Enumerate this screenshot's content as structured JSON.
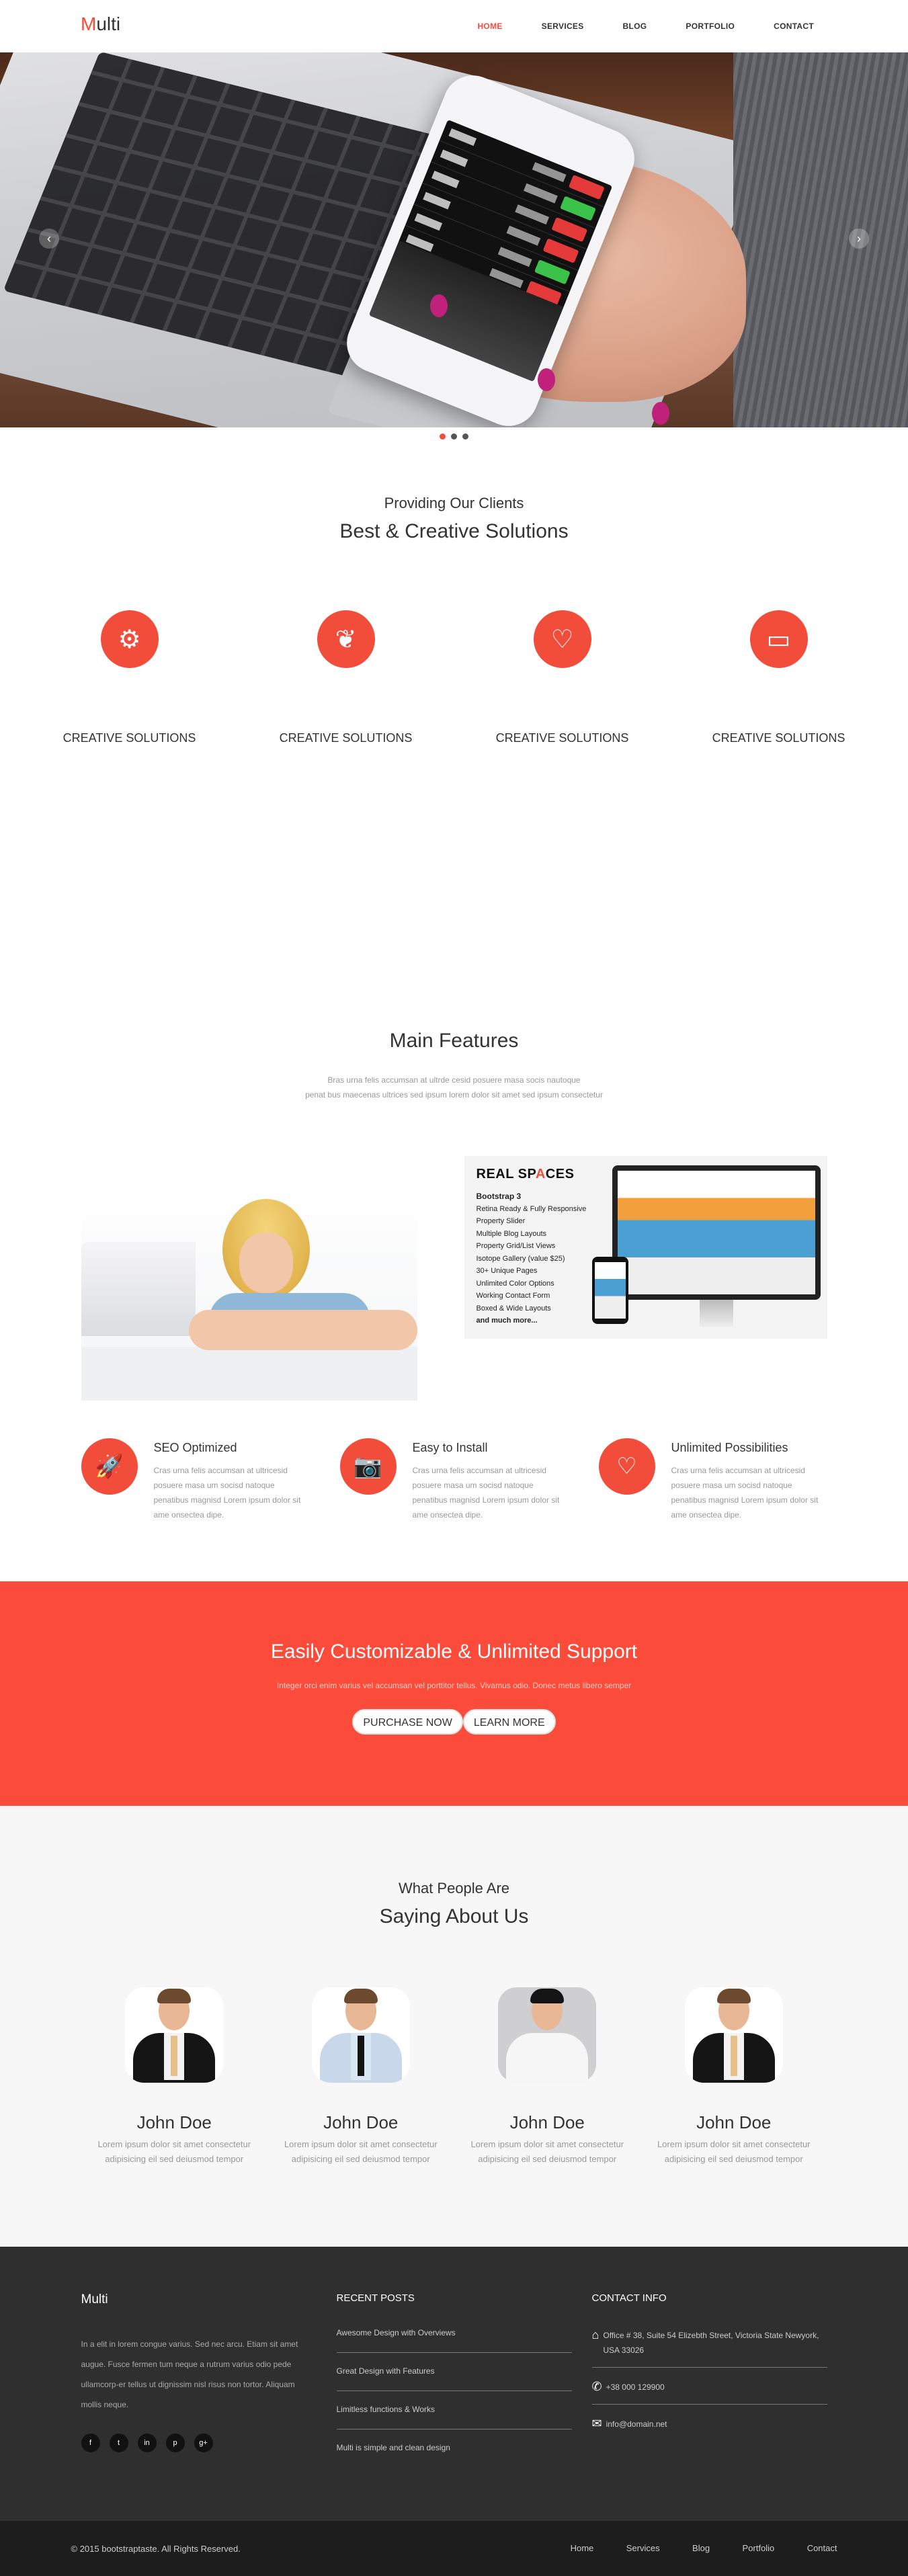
{
  "header": {
    "logo_first": "M",
    "logo_rest": "ulti",
    "nav": [
      {
        "label": "HOME",
        "active": true
      },
      {
        "label": "SERVICES"
      },
      {
        "label": "BLOG"
      },
      {
        "label": "PORTFOLIO"
      },
      {
        "label": "CONTACT"
      }
    ]
  },
  "hero": {
    "prev_icon": "chevron-left-icon",
    "next_icon": "chevron-right-icon",
    "prev_glyph": "‹",
    "next_glyph": "›",
    "slides_count": 3,
    "active_slide": 1
  },
  "solutions": {
    "subtitle": "Providing Our Clients",
    "title": "Best & Creative Solutions",
    "items": [
      {
        "icon": "gears-icon",
        "glyph": "⚙",
        "label": "CREATIVE SOLUTIONS"
      },
      {
        "icon": "leaf-icon",
        "glyph": "❦",
        "label": "CREATIVE SOLUTIONS"
      },
      {
        "icon": "heart-icon",
        "glyph": "♡",
        "label": "CREATIVE SOLUTIONS"
      },
      {
        "icon": "laptop-icon",
        "glyph": "▭",
        "label": "CREATIVE SOLUTIONS"
      }
    ]
  },
  "features": {
    "title": "Main Features",
    "desc_line1": "Bras urna felis accumsan at ultrde cesid posuere masa socis nautoque",
    "desc_line2": "penat bus maecenas ultrices sed ipsum lorem dolor sit amet sed ipsum consectetur",
    "realspaces": {
      "title_a": "REAL SP",
      "title_b": "A",
      "title_c": "CES",
      "list": [
        "Bootstrap 3",
        "Retina Ready & Fully Responsive",
        "Property Slider",
        "Multiple Blog Layouts",
        "Property Grid/List Views",
        "Isotope Gallery (value $25)",
        "30+ Unique Pages",
        "Unlimited Color Options",
        "Working Contact Form",
        "Boxed & Wide Layouts",
        "and much more..."
      ]
    },
    "perks": [
      {
        "icon": "rocket-icon",
        "glyph": "🚀",
        "title": "SEO Optimized",
        "text": "Cras urna felis accumsan at ultricesid posuere masa um socisd natoque penatibus magnisd Lorem ipsum dolor sit ame onsectea dipe."
      },
      {
        "icon": "camera-icon",
        "glyph": "📷",
        "title": "Easy to Install",
        "text": "Cras urna felis accumsan at ultricesid posuere masa um socisd natoque penatibus magnisd Lorem ipsum dolor sit ame onsectea dipe."
      },
      {
        "icon": "heart-icon",
        "glyph": "♡",
        "title": "Unlimited Possibilities",
        "text": "Cras urna felis accumsan at ultricesid posuere masa um socisd natoque penatibus magnisd Lorem ipsum dolor sit ame onsectea dipe."
      }
    ]
  },
  "cta": {
    "title": "Easily Customizable & Unlimited Support",
    "text": "Integer orci enim varius vel accumsan vel porttitor tellus. Vivamus odio. Donec metus libero semper",
    "purchase_label": "PURCHASE NOW",
    "learn_label": "LEARN MORE"
  },
  "testimonials": {
    "subtitle": "What People Are",
    "title": "Saying About Us",
    "people": [
      {
        "name": "John Doe",
        "line1": "Lorem ipsum dolor sit amet consectetur",
        "line2": "adipisicing eil sed deiusmod tempor"
      },
      {
        "name": "John Doe",
        "line1": "Lorem ipsum dolor sit amet consectetur",
        "line2": "adipisicing eil sed deiusmod tempor"
      },
      {
        "name": "John Doe",
        "line1": "Lorem ipsum dolor sit amet consectetur",
        "line2": "adipisicing eil sed deiusmod tempor"
      },
      {
        "name": "John Doe",
        "line1": "Lorem ipsum dolor sit amet consectetur",
        "line2": "adipisicing eil sed deiusmod tempor"
      }
    ]
  },
  "footer": {
    "brand": "Multi",
    "about": "In a elit in lorem congue varius. Sed nec arcu. Etiam sit amet augue. Fusce fermen tum neque a rutrum varius odio pede ullamcorp-er tellus ut dignissim nisl risus non tortor. Aliquam mollis neque.",
    "socials": [
      {
        "icon": "facebook-icon",
        "glyph": "f"
      },
      {
        "icon": "twitter-icon",
        "glyph": "t"
      },
      {
        "icon": "linkedin-icon",
        "glyph": "in"
      },
      {
        "icon": "pinterest-icon",
        "glyph": "p"
      },
      {
        "icon": "google-plus-icon",
        "glyph": "g+"
      }
    ],
    "posts_title": "RECENT POSTS",
    "posts": [
      "Awesome Design with Overviews",
      "Great Design with Features",
      "Limitless functions & Works",
      "Multi is simple and clean design"
    ],
    "contact_title": "CONTACT INFO",
    "contact": [
      {
        "icon": "home-icon",
        "glyph": "⌂",
        "text": "Office # 38, Suite 54 Elizebth Street, Victoria State Newyork, USA 33026"
      },
      {
        "icon": "phone-icon",
        "glyph": "✆",
        "text": "+38 000 129900"
      },
      {
        "icon": "envelope-icon",
        "glyph": "✉",
        "text": "info@domain.net"
      }
    ],
    "copyright": "© 2015 bootstraptaste. All Rights Reserved.",
    "bottom_links": [
      "Home",
      "Services",
      "Blog",
      "Portfolio",
      "Contact"
    ]
  }
}
